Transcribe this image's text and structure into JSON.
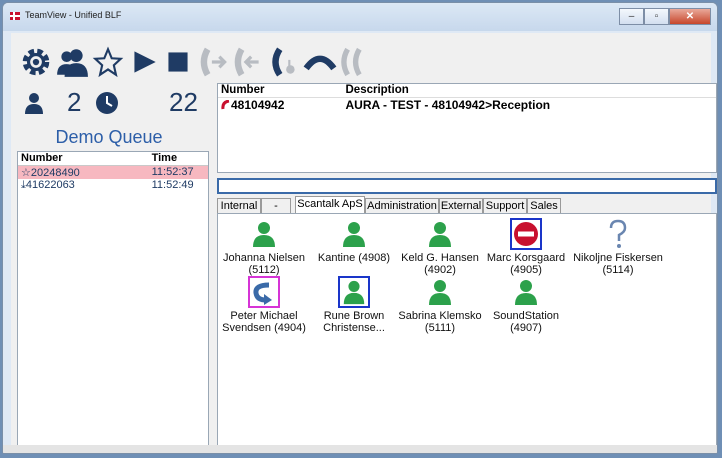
{
  "window": {
    "title": "TeamView - Unified BLF",
    "min": "–",
    "max": "▫",
    "close": "✕"
  },
  "toolbar": {
    "icons": [
      "gear-icon",
      "users-icon",
      "star-icon",
      "play-icon",
      "stop-icon",
      "transfer-in-icon",
      "transfer-out-icon",
      "call-hand-icon",
      "hangup-icon",
      "conference-icon"
    ]
  },
  "stats": {
    "agents": "2",
    "waiting": "22"
  },
  "queue": {
    "name": "Demo Queue",
    "headers": {
      "number": "Number",
      "time": "Time"
    },
    "rows": [
      {
        "number": "☆20248490",
        "time": "11:52:37",
        "highlight": true
      },
      {
        "number": "⤓41622063",
        "time": "11:52:49",
        "highlight": false
      }
    ]
  },
  "calls": {
    "headers": {
      "number": "Number",
      "description": "Description"
    },
    "rows": [
      {
        "number": "48104942",
        "description": "AURA - TEST - 48104942>Reception"
      }
    ]
  },
  "search": {
    "value": ""
  },
  "tabs": [
    "Internal",
    "-",
    "Scantalk ApS",
    "Administration",
    "External",
    "Support",
    "Sales"
  ],
  "active_tab": "Scantalk ApS",
  "contacts": [
    {
      "name": "Johanna Nielsen",
      "ext": "(5112)",
      "status": "available"
    },
    {
      "name": "Kantine (4908)",
      "ext": "",
      "status": "available"
    },
    {
      "name": "Keld G. Hansen",
      "ext": "(4902)",
      "status": "available"
    },
    {
      "name": "Marc Korsgaard",
      "ext": "(4905)",
      "status": "busy"
    },
    {
      "name": "Nikoljne Fiskersen",
      "ext": "(5114)",
      "status": "unknown"
    },
    {
      "name": "Peter Michael",
      "ext": "Svendsen (4904)",
      "status": "forwarded"
    },
    {
      "name": "Rune Brown",
      "ext": "Christense...",
      "status": "selected"
    },
    {
      "name": "Sabrina Klemsko",
      "ext": "(5111)",
      "status": "available"
    },
    {
      "name": "SoundStation",
      "ext": "(4907)",
      "status": "available"
    }
  ],
  "colors": {
    "available": "#2ca14b",
    "busy": "#c8102e",
    "accent": "#2c5ea8"
  }
}
